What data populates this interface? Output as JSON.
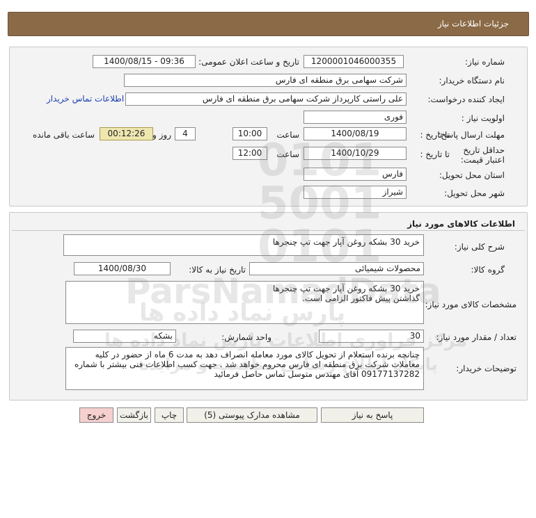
{
  "header": {
    "title": "جزئیات اطلاعات نیاز"
  },
  "info": {
    "need_number_label": "شماره نیاز:",
    "need_number": "1200001046000355",
    "announce_label": "تاریخ و ساعت اعلان عمومی:",
    "announce_value": "1400/08/15 - 09:36",
    "buyer_org_label": "نام دستگاه خریدار:",
    "buyer_org": "شرکت سهامی برق منطقه ای فارس",
    "creator_label": "ایجاد کننده درخواست:",
    "creator": "علی راستی کارپرداز شرکت سهامی برق منطقه ای فارس",
    "contact_link": "اطلاعات تماس خریدار",
    "priority_label": "اولویت نیاز :",
    "priority": "فوری",
    "deadline_label": "مهلت ارسال پاسخ:",
    "to_date_label": "تا تاریخ :",
    "deadline_date": "1400/08/19",
    "time_label": "ساعت",
    "deadline_time": "10:00",
    "days_value": "4",
    "days_label": "روز و",
    "remaining_time": "00:12:26",
    "remaining_label": "ساعت باقی مانده",
    "validity_label": "حداقل تاریخ اعتبار قیمت:",
    "validity_date": "1400/10/29",
    "validity_time": "12:00",
    "province_label": "استان محل تحویل:",
    "province": "فارس",
    "city_label": "شهر محل تحویل:",
    "city": "شیراز"
  },
  "goods": {
    "section_title": "اطلاعات کالاهای مورد نیاز",
    "general_desc_label": "شرح کلی نیاز:",
    "general_desc": "خرید 30 بشکه روغن آپار جهت تپ چنجرها",
    "group_label": "گروه کالا:",
    "group": "محصولات شیمیائی",
    "need_date_label": "تاریخ نیاز به کالا:",
    "need_date": "1400/08/30",
    "specs_label": "مشخصات کالای مورد نیاز:",
    "specs_line1": "خرید 30 بشکه روغن آپار جهت تپ چنجرها",
    "specs_line2": "گذاشتن پیش فاکتور الزامی است.",
    "qty_label": "تعداد / مقدار مورد نیاز:",
    "qty": "30",
    "unit_label": "واحد شمارش:",
    "unit": "بشکه",
    "buyer_notes_label": "توضیحات خریدار:",
    "buyer_notes": "چنانچه برنده استعلام از تحویل کالای مورد معامله انصراف دهد به مدت 6 ماه از حضور در کلیه معاملات شرکت برق منطقه ای فارس محروم خواهد شد . جهت کسب اطلاعات فنی بیشتر با شماره 09177137282 آقای مهندس متوسل تماس حاصل فرمائید"
  },
  "buttons": {
    "reply": "پاسخ به نیاز",
    "attachments": "مشاهده مدارک پیوستی (5)",
    "print": "چاپ",
    "back": "بازگشت",
    "exit": "خروج"
  },
  "watermark": {
    "brand": "ParsNamadData",
    "line1": "پارس نماد داده ها",
    "line2": "مرکز فراوری اطلاعات پارس نماد داده ها",
    "line3": "پایگاه اطلاع رسانی مناقصه و مزایده"
  },
  "colors": {
    "header_bg": "#8b6a47",
    "panel_bg": "#f3f3f3",
    "timer_bg": "#efe7b0",
    "exit_bg": "#f6cfcf",
    "link": "#1a3fb3"
  }
}
